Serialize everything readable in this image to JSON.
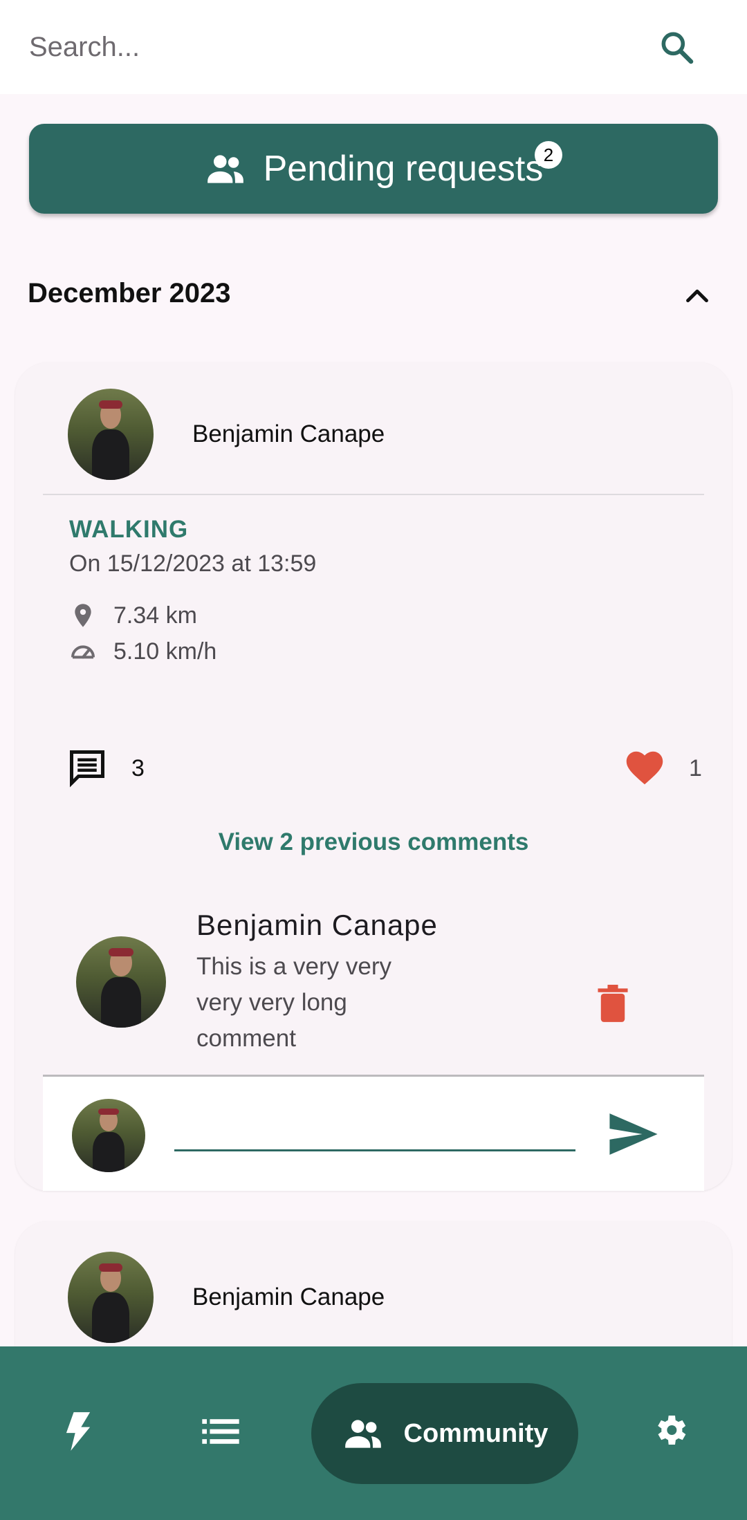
{
  "search": {
    "placeholder": "Search..."
  },
  "pending": {
    "label": "Pending requests",
    "badge": "2"
  },
  "month": {
    "title": "December 2023"
  },
  "posts": [
    {
      "user_name": "Benjamin Canape",
      "activity_type": "WALKING",
      "date": "On 15/12/2023 at 13:59",
      "distance": "7.34 km",
      "speed": "5.10 km/h",
      "comments_count": "3",
      "likes_count": "1",
      "view_previous": "View 2 previous comments",
      "comment": {
        "author": "Benjamin Canape",
        "text": "This is a very very very very long comment"
      }
    },
    {
      "user_name": "Benjamin Canape"
    }
  ],
  "nav": {
    "active_label": "Community"
  },
  "colors": {
    "primary": "#2d6962",
    "nav_bg": "#33786b",
    "nav_active": "#1e4b42",
    "accent_text": "#2f7a6c",
    "danger": "#e0533f"
  }
}
